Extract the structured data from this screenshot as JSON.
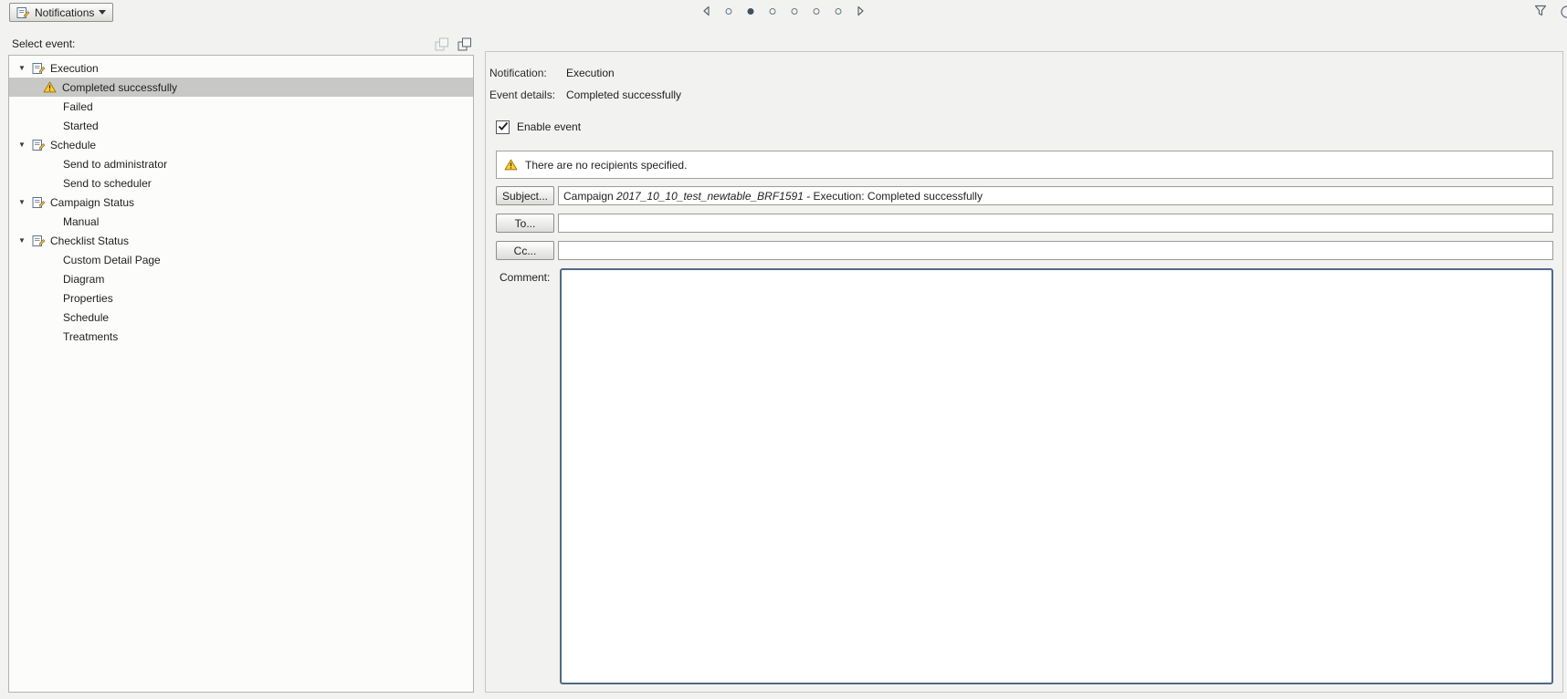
{
  "toolbar": {
    "notifications_button": "Notifications",
    "pager": {
      "dot_count": 6,
      "active_index": 1
    }
  },
  "tree_panel": {
    "title": "Select event:",
    "groups": [
      {
        "label": "Execution",
        "children": [
          {
            "label": "Completed successfully",
            "selected": true,
            "warning": true
          },
          {
            "label": "Failed"
          },
          {
            "label": "Started"
          }
        ]
      },
      {
        "label": "Schedule",
        "children": [
          {
            "label": "Send to administrator"
          },
          {
            "label": "Send to scheduler"
          }
        ]
      },
      {
        "label": "Campaign Status",
        "children": [
          {
            "label": "Manual"
          }
        ]
      },
      {
        "label": "Checklist Status",
        "children": [
          {
            "label": "Custom Detail Page"
          },
          {
            "label": "Diagram"
          },
          {
            "label": "Properties"
          },
          {
            "label": "Schedule"
          },
          {
            "label": "Treatments"
          }
        ]
      }
    ]
  },
  "detail": {
    "notification_label": "Notification:",
    "notification_value": "Execution",
    "event_details_label": "Event details:",
    "event_details_value": "Completed successfully",
    "enable_event_label": "Enable event",
    "enable_event_checked": true,
    "warning_message": "There are no recipients specified.",
    "subject_button": "Subject...",
    "subject_prefix": "Campaign ",
    "subject_campaign_name": "2017_10_10_test_newtable_BRF1591",
    "subject_suffix": " - Execution: Completed successfully",
    "to_button": "To...",
    "to_value": "",
    "cc_button": "Cc...",
    "cc_value": "",
    "comment_label": "Comment:",
    "comment_value": ""
  },
  "colors": {
    "selection": "#c8c8c6",
    "warning_yellow": "#fbca3a",
    "comment_border": "#4f6a87"
  }
}
